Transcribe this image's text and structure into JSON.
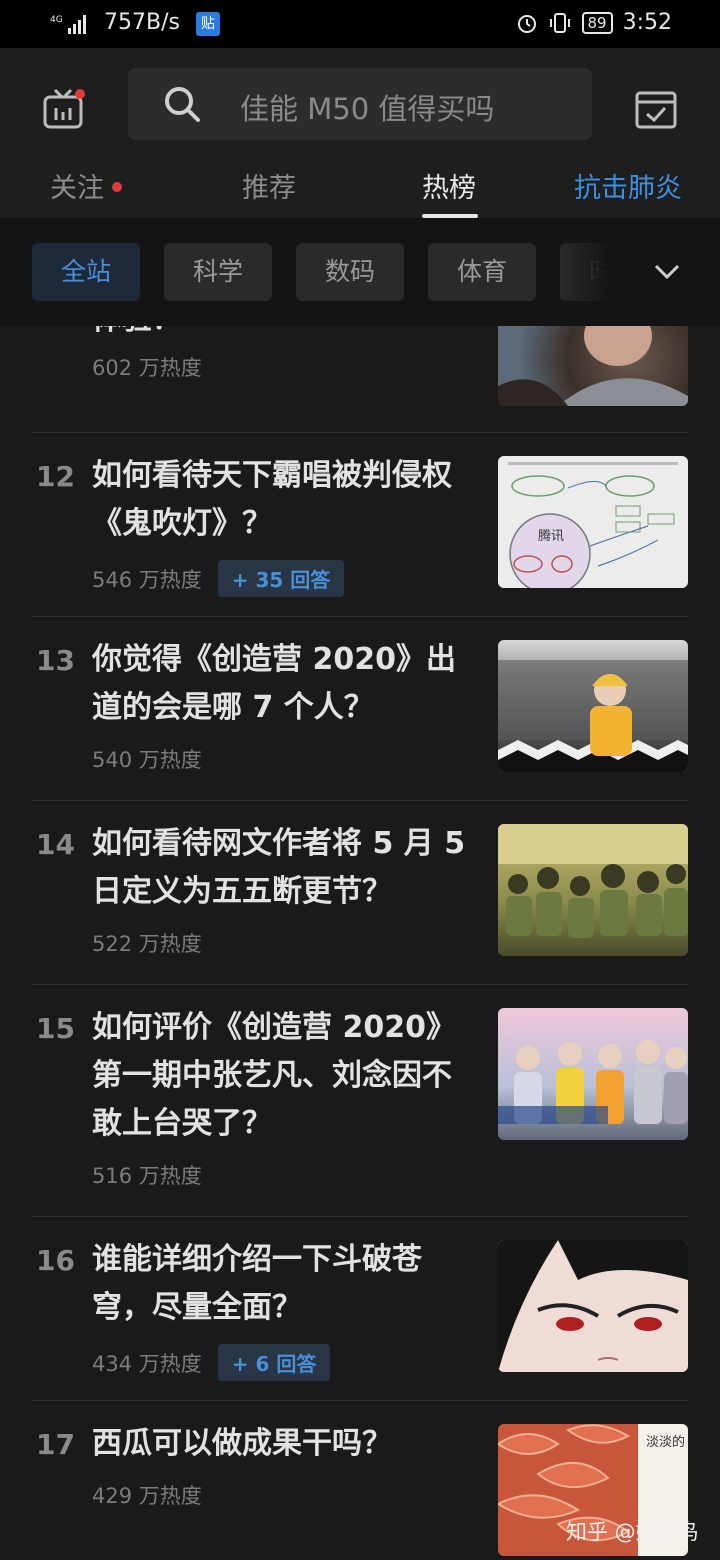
{
  "status_bar": {
    "network": "4G",
    "speed": "757B/s",
    "app_badge": "贴",
    "battery": "89",
    "time": "3:52"
  },
  "header": {
    "search_placeholder": "佳能 M50 值得买吗",
    "tabs": [
      {
        "label": "关注",
        "has_dot": true
      },
      {
        "label": "推荐"
      },
      {
        "label": "热榜",
        "active": true
      },
      {
        "label": "抗击肺炎",
        "highlight": true
      }
    ]
  },
  "filters": [
    {
      "label": "全站",
      "active": true
    },
    {
      "label": "科学"
    },
    {
      "label": "数码"
    },
    {
      "label": "体育"
    },
    {
      "label": "时尚"
    }
  ],
  "list": [
    {
      "rank": "",
      "title": "体验？",
      "heat": "602 万热度"
    },
    {
      "rank": "12",
      "title": "如何看待天下霸唱被判侵权《鬼吹灯》？",
      "heat": "546 万热度",
      "answers": "+ 35 回答"
    },
    {
      "rank": "13",
      "title": "你觉得《创造营 2020》出道的会是哪 7 个人？",
      "heat": "540 万热度"
    },
    {
      "rank": "14",
      "title": "如何看待网文作者将 5 月 5 日定义为五五断更节？",
      "heat": "522 万热度"
    },
    {
      "rank": "15",
      "title": "如何评价《创造营 2020》第一期中张艺凡、刘念因不敢上台哭了？",
      "heat": "516 万热度"
    },
    {
      "rank": "16",
      "title": "谁能详细介绍一下斗破苍穹，尽量全面？",
      "heat": "434 万热度",
      "answers": "+ 6 回答"
    },
    {
      "rank": "17",
      "title": "西瓜可以做成果干吗？",
      "heat": "429 万热度"
    }
  ],
  "thumb_texts": {
    "diagram_center": "腾讯",
    "watermelon_book": "淡淡的"
  },
  "watermark": "知乎 @嬉笑鸟",
  "colors": {
    "accent": "#3d8fe0",
    "background": "#1a1a1a",
    "dot": "#e03a3a"
  }
}
